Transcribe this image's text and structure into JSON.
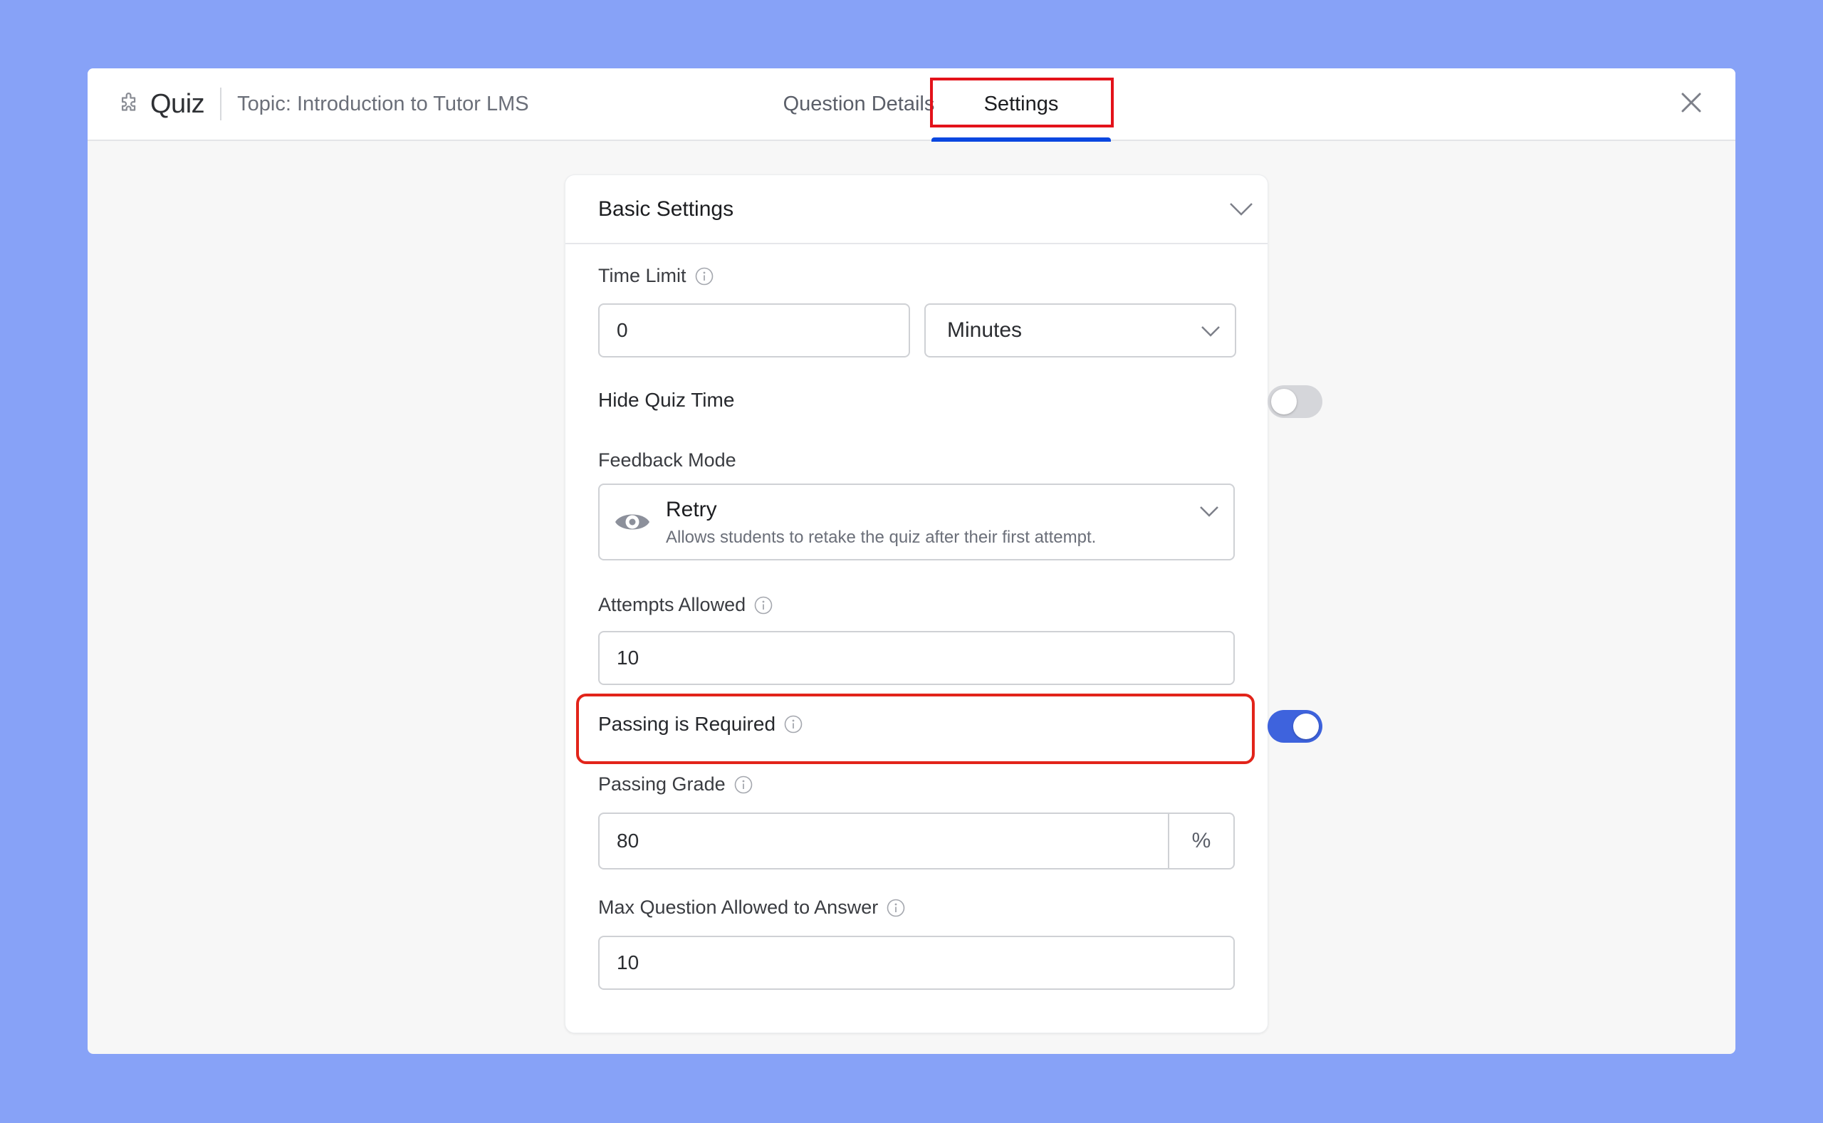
{
  "header": {
    "app_icon": "puzzle-icon",
    "title": "Quiz",
    "topic": "Topic: Introduction to Tutor LMS",
    "tabs": [
      {
        "label": "Question Details",
        "active": false
      },
      {
        "label": "Settings",
        "active": true
      }
    ],
    "close_icon": "close-icon"
  },
  "card": {
    "title": "Basic Settings",
    "fields": {
      "time_limit": {
        "label": "Time Limit",
        "value": "0",
        "unit": "Minutes"
      },
      "hide_quiz_time": {
        "label": "Hide Quiz Time",
        "enabled": false
      },
      "feedback_mode": {
        "label": "Feedback Mode",
        "icon": "eye-icon",
        "value": "Retry",
        "description": "Allows students to retake the quiz after their first attempt."
      },
      "attempts_allowed": {
        "label": "Attempts Allowed",
        "value": "10"
      },
      "passing_required": {
        "label": "Passing is Required",
        "enabled": true
      },
      "passing_grade": {
        "label": "Passing Grade",
        "value": "80",
        "suffix": "%"
      },
      "max_questions": {
        "label": "Max Question Allowed to Answer",
        "value": "10"
      }
    }
  },
  "colors": {
    "background": "#87a2f7",
    "accent": "#0a47e0",
    "toggle_on": "#3e63dd",
    "highlight": "#e3121a"
  }
}
